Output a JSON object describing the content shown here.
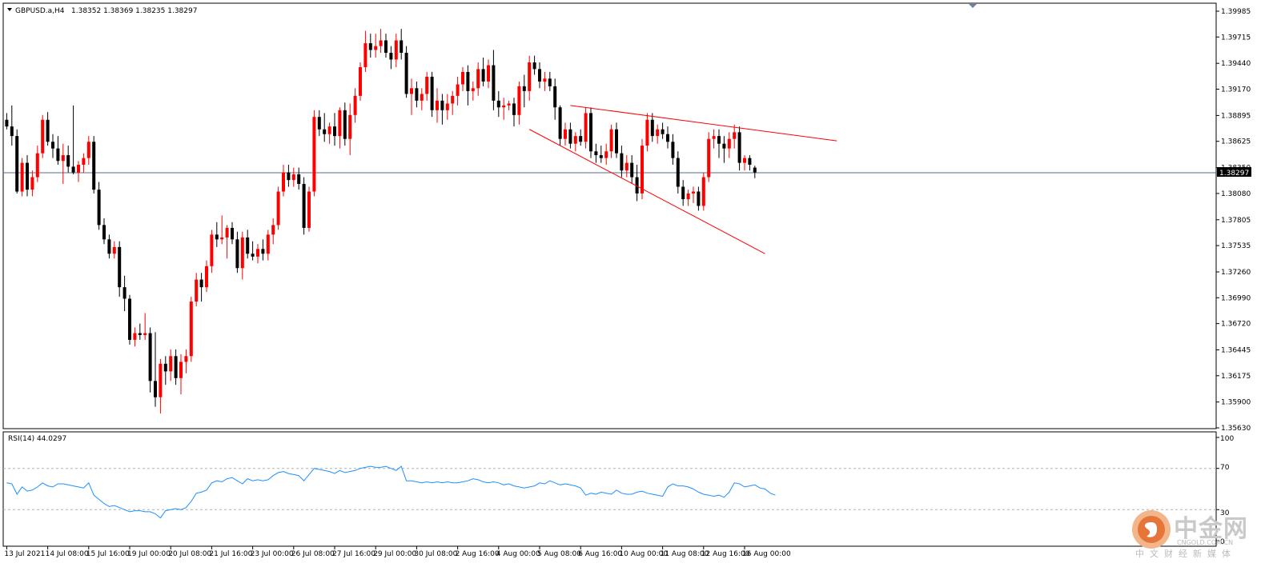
{
  "header": {
    "symbol": "GBPUSD.a,H4",
    "ohlc": "1.38352 1.38369 1.38235 1.38297"
  },
  "price_axis": {
    "current_price_label": "1.38297",
    "current_price": 1.38297
  },
  "rsi": {
    "label": "RSI(14) 44.0297",
    "levels": [
      "100",
      "70",
      "30",
      "0"
    ]
  },
  "colors": {
    "bull": "#ff0000",
    "bear": "#000000",
    "rsi_line": "#1e90ff",
    "trendline": "#ff0000",
    "price_line": "#5a6b8c"
  },
  "watermark": {
    "cn": "中金网",
    "en": "CNGOLD.COM.CN",
    "sub": "中文财经新媒体"
  },
  "chart_data": {
    "type": "candlestick",
    "symbol": "GBPUSD.a",
    "timeframe": "H4",
    "ylim": [
      1.3563,
      1.39985
    ],
    "y_ticks": [
      "1.39985",
      "1.39715",
      "1.39440",
      "1.39170",
      "1.38895",
      "1.38625",
      "1.38350",
      "1.38080",
      "1.37805",
      "1.37535",
      "1.37260",
      "1.36990",
      "1.36720",
      "1.36445",
      "1.36175",
      "1.35900",
      "1.35630"
    ],
    "x_ticks": [
      "13 Jul 2021",
      "14 Jul 08:00",
      "15 Jul 16:00",
      "19 Jul 00:00",
      "20 Jul 08:00",
      "21 Jul 16:00",
      "23 Jul 00:00",
      "26 Jul 08:00",
      "27 Jul 16:00",
      "29 Jul 00:00",
      "30 Jul 08:00",
      "2 Aug 16:00",
      "4 Aug 00:00",
      "5 Aug 08:00",
      "6 Aug 16:00",
      "10 Aug 00:00",
      "11 Aug 08:00",
      "12 Aug 16:00",
      "16 Aug 00:00"
    ],
    "x_tick_bar_index": [
      0,
      8,
      16,
      24,
      32,
      40,
      48,
      56,
      64,
      72,
      80,
      88,
      96,
      104,
      112,
      120,
      128,
      136,
      144
    ],
    "candles": [
      [
        1.3885,
        1.3892,
        1.3875,
        1.3878
      ],
      [
        1.3878,
        1.39,
        1.3858,
        1.3868
      ],
      [
        1.3868,
        1.3875,
        1.3808,
        1.381
      ],
      [
        1.381,
        1.3845,
        1.3805,
        1.384
      ],
      [
        1.384,
        1.3848,
        1.3805,
        1.3812
      ],
      [
        1.3812,
        1.3832,
        1.3805,
        1.3825
      ],
      [
        1.3825,
        1.3858,
        1.382,
        1.385
      ],
      [
        1.385,
        1.389,
        1.3845,
        1.3885
      ],
      [
        1.3885,
        1.3893,
        1.3858,
        1.3862
      ],
      [
        1.3862,
        1.387,
        1.3845,
        1.3855
      ],
      [
        1.3855,
        1.3868,
        1.3838,
        1.3842
      ],
      [
        1.3842,
        1.386,
        1.3818,
        1.3848
      ],
      [
        1.3848,
        1.3858,
        1.383,
        1.3836
      ],
      [
        1.3836,
        1.39,
        1.3828,
        1.383
      ],
      [
        1.383,
        1.3842,
        1.382,
        1.3838
      ],
      [
        1.3838,
        1.385,
        1.383,
        1.3845
      ],
      [
        1.3845,
        1.3868,
        1.3838,
        1.3862
      ],
      [
        1.3862,
        1.3868,
        1.3808,
        1.3812
      ],
      [
        1.3812,
        1.382,
        1.377,
        1.3775
      ],
      [
        1.3775,
        1.3782,
        1.3755,
        1.376
      ],
      [
        1.376,
        1.3765,
        1.374,
        1.3745
      ],
      [
        1.3745,
        1.3758,
        1.374,
        1.3752
      ],
      [
        1.3752,
        1.3758,
        1.37,
        1.371
      ],
      [
        1.371,
        1.3722,
        1.3685,
        1.3698
      ],
      [
        1.3698,
        1.3702,
        1.365,
        1.3655
      ],
      [
        1.3655,
        1.3668,
        1.3648,
        1.3662
      ],
      [
        1.3662,
        1.3672,
        1.3655,
        1.366
      ],
      [
        1.366,
        1.3683,
        1.3655,
        1.3662
      ],
      [
        1.3662,
        1.3668,
        1.36,
        1.3612
      ],
      [
        1.3612,
        1.3663,
        1.3585,
        1.3595
      ],
      [
        1.3595,
        1.3635,
        1.3578,
        1.363
      ],
      [
        1.363,
        1.3638,
        1.3608,
        1.3622
      ],
      [
        1.3622,
        1.3645,
        1.3612,
        1.3638
      ],
      [
        1.3638,
        1.3645,
        1.3608,
        1.3615
      ],
      [
        1.3615,
        1.364,
        1.3598,
        1.3632
      ],
      [
        1.3632,
        1.3645,
        1.362,
        1.3638
      ],
      [
        1.3638,
        1.37,
        1.3632,
        1.3695
      ],
      [
        1.3695,
        1.3725,
        1.369,
        1.3718
      ],
      [
        1.3718,
        1.3725,
        1.3695,
        1.371
      ],
      [
        1.371,
        1.3738,
        1.3705,
        1.3732
      ],
      [
        1.3732,
        1.377,
        1.3725,
        1.3765
      ],
      [
        1.3765,
        1.3778,
        1.3752,
        1.376
      ],
      [
        1.376,
        1.3785,
        1.3755,
        1.3762
      ],
      [
        1.3762,
        1.3775,
        1.374,
        1.3772
      ],
      [
        1.3772,
        1.3778,
        1.3755,
        1.376
      ],
      [
        1.376,
        1.3768,
        1.3725,
        1.373
      ],
      [
        1.373,
        1.3768,
        1.3718,
        1.3762
      ],
      [
        1.3762,
        1.377,
        1.374,
        1.3745
      ],
      [
        1.3745,
        1.3758,
        1.3738,
        1.3742
      ],
      [
        1.3742,
        1.3755,
        1.3735,
        1.375
      ],
      [
        1.375,
        1.376,
        1.3738,
        1.3745
      ],
      [
        1.3745,
        1.377,
        1.3738,
        1.3765
      ],
      [
        1.3765,
        1.3782,
        1.3755,
        1.3775
      ],
      [
        1.3775,
        1.3815,
        1.377,
        1.381
      ],
      [
        1.381,
        1.3838,
        1.3805,
        1.383
      ],
      [
        1.383,
        1.3838,
        1.3815,
        1.3822
      ],
      [
        1.3822,
        1.3835,
        1.3815,
        1.3828
      ],
      [
        1.3828,
        1.3835,
        1.3812,
        1.3818
      ],
      [
        1.3818,
        1.3825,
        1.3765,
        1.3772
      ],
      [
        1.3772,
        1.3815,
        1.3768,
        1.381
      ],
      [
        1.381,
        1.3895,
        1.3805,
        1.3888
      ],
      [
        1.3888,
        1.3895,
        1.3868,
        1.3875
      ],
      [
        1.3875,
        1.3892,
        1.3862,
        1.387
      ],
      [
        1.387,
        1.3882,
        1.386,
        1.3878
      ],
      [
        1.3878,
        1.3892,
        1.3858,
        1.3868
      ],
      [
        1.3868,
        1.3898,
        1.3855,
        1.3895
      ],
      [
        1.3895,
        1.3903,
        1.3858,
        1.3865
      ],
      [
        1.3865,
        1.3902,
        1.3848,
        1.389
      ],
      [
        1.389,
        1.3918,
        1.3882,
        1.391
      ],
      [
        1.391,
        1.3945,
        1.3905,
        1.394
      ],
      [
        1.394,
        1.3978,
        1.3935,
        1.3965
      ],
      [
        1.3965,
        1.3975,
        1.395,
        1.3958
      ],
      [
        1.3958,
        1.3975,
        1.395,
        1.3962
      ],
      [
        1.3962,
        1.398,
        1.3955,
        1.3968
      ],
      [
        1.3968,
        1.3975,
        1.395,
        1.3955
      ],
      [
        1.3955,
        1.3962,
        1.3938,
        1.3948
      ],
      [
        1.3948,
        1.3975,
        1.394,
        1.3968
      ],
      [
        1.3968,
        1.398,
        1.3948,
        1.3955
      ],
      [
        1.3955,
        1.3962,
        1.3908,
        1.3912
      ],
      [
        1.3912,
        1.3928,
        1.389,
        1.3918
      ],
      [
        1.3918,
        1.3925,
        1.3898,
        1.3905
      ],
      [
        1.3905,
        1.3918,
        1.3895,
        1.3912
      ],
      [
        1.3912,
        1.3935,
        1.3905,
        1.393
      ],
      [
        1.393,
        1.3935,
        1.3888,
        1.3895
      ],
      [
        1.3895,
        1.3918,
        1.3882,
        1.3905
      ],
      [
        1.3905,
        1.3912,
        1.388,
        1.3895
      ],
      [
        1.3895,
        1.3912,
        1.3885,
        1.3902
      ],
      [
        1.3902,
        1.3915,
        1.389,
        1.391
      ],
      [
        1.391,
        1.393,
        1.39,
        1.3922
      ],
      [
        1.3922,
        1.394,
        1.3915,
        1.3935
      ],
      [
        1.3935,
        1.3942,
        1.39,
        1.3915
      ],
      [
        1.3915,
        1.3925,
        1.3905,
        1.3918
      ],
      [
        1.3918,
        1.3945,
        1.391,
        1.3938
      ],
      [
        1.3938,
        1.395,
        1.392,
        1.3925
      ],
      [
        1.3925,
        1.3948,
        1.3918,
        1.3942
      ],
      [
        1.3942,
        1.3958,
        1.3895,
        1.3905
      ],
      [
        1.3905,
        1.3915,
        1.3888,
        1.3898
      ],
      [
        1.3898,
        1.3908,
        1.3885,
        1.39
      ],
      [
        1.39,
        1.3905,
        1.3895,
        1.3902
      ],
      [
        1.3902,
        1.3908,
        1.3878,
        1.389
      ],
      [
        1.389,
        1.3925,
        1.388,
        1.392
      ],
      [
        1.392,
        1.3932,
        1.3898,
        1.3915
      ],
      [
        1.3915,
        1.3952,
        1.3905,
        1.3945
      ],
      [
        1.3945,
        1.3952,
        1.3932,
        1.3938
      ],
      [
        1.3938,
        1.3945,
        1.3918,
        1.3925
      ],
      [
        1.3925,
        1.3935,
        1.3915,
        1.3928
      ],
      [
        1.3928,
        1.3935,
        1.3915,
        1.392
      ],
      [
        1.392,
        1.3928,
        1.3885,
        1.3898
      ],
      [
        1.3898,
        1.39,
        1.3858,
        1.3865
      ],
      [
        1.3865,
        1.3882,
        1.3858,
        1.3875
      ],
      [
        1.3875,
        1.3882,
        1.3855,
        1.386
      ],
      [
        1.386,
        1.3872,
        1.3852,
        1.3868
      ],
      [
        1.3868,
        1.3875,
        1.3858,
        1.3862
      ],
      [
        1.3862,
        1.3898,
        1.3855,
        1.3892
      ],
      [
        1.3892,
        1.3898,
        1.3845,
        1.3852
      ],
      [
        1.3852,
        1.386,
        1.384,
        1.3848
      ],
      [
        1.3848,
        1.3858,
        1.384,
        1.3845
      ],
      [
        1.3845,
        1.386,
        1.3838,
        1.3852
      ],
      [
        1.3852,
        1.388,
        1.3845,
        1.3875
      ],
      [
        1.3875,
        1.3882,
        1.3845,
        1.385
      ],
      [
        1.385,
        1.3858,
        1.3825,
        1.3832
      ],
      [
        1.3832,
        1.3848,
        1.3825,
        1.384
      ],
      [
        1.384,
        1.3848,
        1.3818,
        1.3825
      ],
      [
        1.3825,
        1.3838,
        1.38,
        1.3808
      ],
      [
        1.3808,
        1.3865,
        1.3802,
        1.3858
      ],
      [
        1.3858,
        1.3892,
        1.3852,
        1.3885
      ],
      [
        1.3885,
        1.3892,
        1.3862,
        1.3868
      ],
      [
        1.3868,
        1.388,
        1.386,
        1.3875
      ],
      [
        1.3875,
        1.3882,
        1.3865,
        1.387
      ],
      [
        1.387,
        1.3878,
        1.3855,
        1.3862
      ],
      [
        1.3862,
        1.387,
        1.3838,
        1.3845
      ],
      [
        1.3845,
        1.3852,
        1.3808,
        1.3815
      ],
      [
        1.3815,
        1.3822,
        1.3795,
        1.3802
      ],
      [
        1.3802,
        1.3812,
        1.3795,
        1.3808
      ],
      [
        1.3808,
        1.3815,
        1.3798,
        1.381
      ],
      [
        1.381,
        1.3815,
        1.379,
        1.3795
      ],
      [
        1.3795,
        1.383,
        1.379,
        1.3825
      ],
      [
        1.3825,
        1.3872,
        1.382,
        1.3865
      ],
      [
        1.3865,
        1.3875,
        1.3855,
        1.3868
      ],
      [
        1.3868,
        1.3875,
        1.3845,
        1.386
      ],
      [
        1.386,
        1.3868,
        1.384,
        1.3855
      ],
      [
        1.3855,
        1.3872,
        1.3845,
        1.3865
      ],
      [
        1.3865,
        1.388,
        1.3855,
        1.3872
      ],
      [
        1.3872,
        1.3878,
        1.3832,
        1.384
      ],
      [
        1.384,
        1.3848,
        1.3832,
        1.3845
      ],
      [
        1.3845,
        1.3848,
        1.3832,
        1.3838
      ],
      [
        1.3835,
        1.3837,
        1.3824,
        1.383
      ]
    ],
    "trendlines": [
      {
        "from": {
          "bar": 110,
          "price": 1.39
        },
        "to": {
          "bar": 162,
          "price": 1.3863
        }
      },
      {
        "from": {
          "bar": 102,
          "price": 1.3875
        },
        "to": {
          "bar": 148,
          "price": 1.3745
        }
      }
    ],
    "rsi_values": [
      56,
      55,
      45,
      52,
      48,
      49,
      52,
      56,
      53,
      52,
      55,
      55,
      54,
      53,
      52,
      51,
      56,
      44,
      40,
      36,
      33,
      34,
      32,
      30,
      28,
      29,
      29,
      28,
      28,
      26,
      22,
      29,
      30,
      31,
      30,
      32,
      38,
      46,
      47,
      49,
      56,
      58,
      57,
      60,
      61,
      58,
      55,
      60,
      58,
      59,
      58,
      59,
      63,
      66,
      67,
      65,
      64,
      63,
      58,
      64,
      70,
      69,
      68,
      67,
      65,
      68,
      66,
      67,
      68,
      70,
      71,
      72,
      71,
      71,
      72,
      70,
      68,
      72,
      58,
      58,
      57,
      56,
      57,
      56,
      57,
      56,
      57,
      56,
      56,
      57,
      58,
      60,
      59,
      57,
      56,
      57,
      56,
      54,
      55,
      53,
      52,
      51,
      52,
      53,
      56,
      55,
      58,
      56,
      54,
      55,
      54,
      53,
      51,
      44,
      46,
      45,
      47,
      46,
      45,
      49,
      46,
      45,
      45,
      47,
      48,
      46,
      45,
      44,
      43,
      52,
      55,
      53,
      53,
      52,
      50,
      47,
      45,
      44,
      43,
      44,
      42,
      47,
      56,
      55,
      52,
      53,
      54,
      51,
      50,
      46,
      44
    ]
  }
}
